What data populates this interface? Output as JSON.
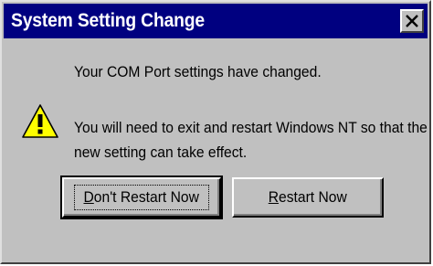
{
  "window": {
    "title": "System Setting Change",
    "close_label": "X"
  },
  "message": {
    "line1": "Your COM Port settings have changed.",
    "line2a": "You will need to exit and restart Windows NT so that the",
    "line2b": "new setting can take effect."
  },
  "buttons": {
    "dont_restart": {
      "mnemonic": "D",
      "rest": "on't Restart Now"
    },
    "restart": {
      "mnemonic": "R",
      "rest": "estart Now"
    }
  },
  "icons": {
    "warning": "warning-icon",
    "close": "close-icon"
  },
  "colors": {
    "titlebar": "#000080",
    "dialog_face": "#c0c0c0",
    "warning_fill": "#ffff00"
  }
}
